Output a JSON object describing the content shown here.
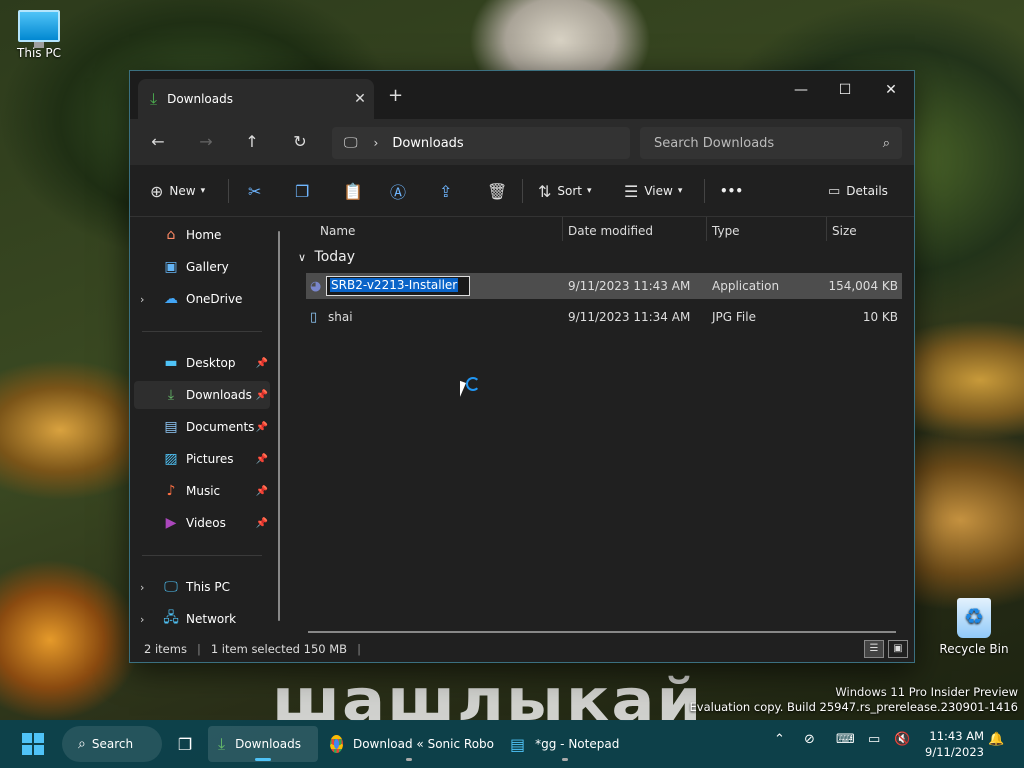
{
  "desktop": {
    "this_pc_label": "This PC",
    "recycle_bin_label": "Recycle Bin",
    "watermark_line1": "Windows 11 Pro Insider Preview",
    "watermark_line2": "Evaluation copy. Build 25947.rs_prerelease.230901-1416",
    "wallpaper_text": "шашлыкай"
  },
  "window": {
    "tab_title": "Downloads",
    "tab_close": "✕",
    "new_tab": "+",
    "minimize": "—",
    "maximize": "☐",
    "close": "✕"
  },
  "nav": {
    "back": "←",
    "forward": "→",
    "up": "↑",
    "refresh": "↻",
    "address_location": "Downloads",
    "search_placeholder": "Search Downloads"
  },
  "toolbar": {
    "new_label": "New",
    "sort_label": "Sort",
    "view_label": "View",
    "more_label": "•••",
    "details_label": "Details"
  },
  "sidebar": {
    "items": [
      {
        "label": "Home",
        "icon": "home-icon"
      },
      {
        "label": "Gallery",
        "icon": "gallery-icon"
      },
      {
        "label": "OneDrive",
        "icon": "cloud-icon"
      },
      {
        "label": "Desktop",
        "icon": "desktop-icon"
      },
      {
        "label": "Downloads",
        "icon": "download-icon"
      },
      {
        "label": "Documents",
        "icon": "document-icon"
      },
      {
        "label": "Pictures",
        "icon": "picture-icon"
      },
      {
        "label": "Music",
        "icon": "music-icon"
      },
      {
        "label": "Videos",
        "icon": "video-icon"
      },
      {
        "label": "This PC",
        "icon": "pc-icon"
      },
      {
        "label": "Network",
        "icon": "network-icon"
      }
    ]
  },
  "columns": {
    "name": "Name",
    "date": "Date modified",
    "type": "Type",
    "size": "Size"
  },
  "group_label": "Today",
  "files": [
    {
      "name": "SRB2-v2213-Installer",
      "date": "9/11/2023 11:43 AM",
      "type": "Application",
      "size": "154,004 KB"
    },
    {
      "name": "shai",
      "date": "9/11/2023 11:34 AM",
      "type": "JPG File",
      "size": "10 KB"
    }
  ],
  "status": {
    "count": "2 items",
    "selected": "1 item selected  150 MB"
  },
  "taskbar": {
    "search_label": "Search",
    "downloads_label": "Downloads",
    "chrome_label": "Download « Sonic Robo",
    "notepad_label": "*gg - Notepad",
    "time": "11:43 AM",
    "date": "9/11/2023"
  },
  "colors": {
    "accent": "#4fc3f7",
    "selection": "#0a64c8",
    "window_bg": "#202020"
  }
}
